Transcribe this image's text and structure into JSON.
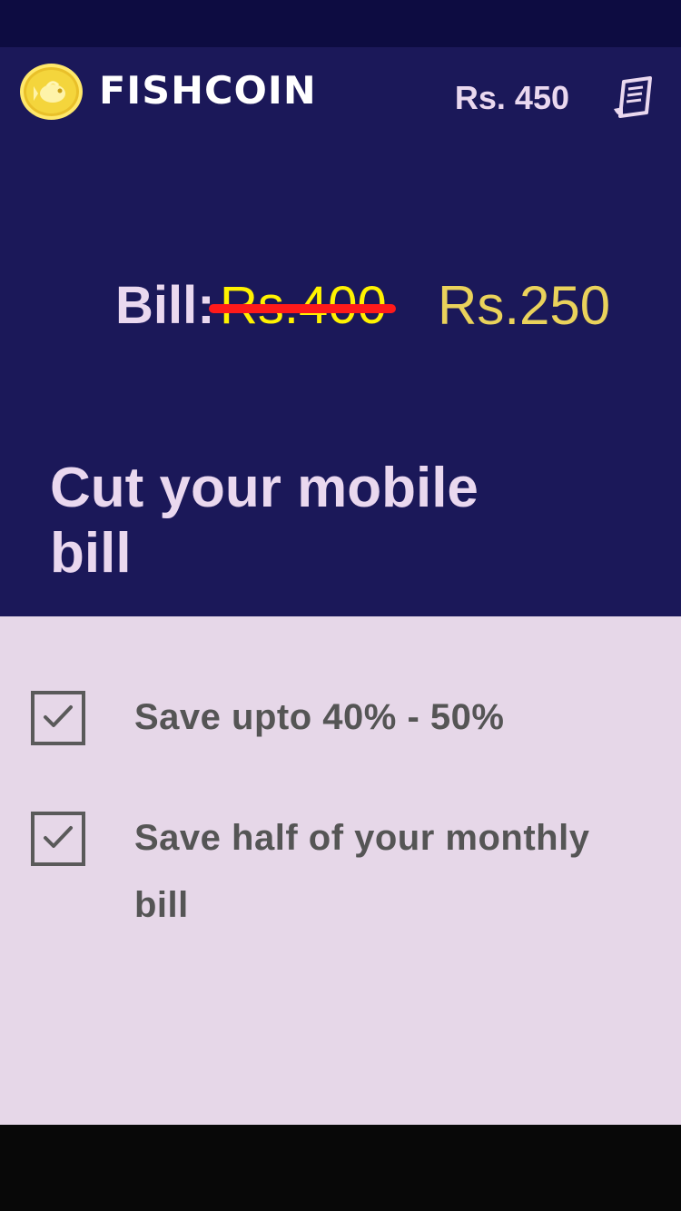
{
  "app": {
    "name": "FISHCOIN",
    "balance": "Rs. 450",
    "logo_icon": "fish-coin-icon",
    "receipt_icon": "receipt-icon"
  },
  "bill": {
    "label": "Bill:",
    "old_price": "Rs.400",
    "new_price": "Rs.250"
  },
  "hero": {
    "title": "Cut your mobile bill"
  },
  "features": [
    {
      "text": "Save upto 40% - 50%",
      "checked": true
    },
    {
      "text": "Save half of your monthly bill",
      "checked": true
    }
  ],
  "colors": {
    "status_bar": "#0d0c41",
    "hero_background": "#1b1859",
    "features_background": "#e6d7e8",
    "accent_yellow": "#ead25b",
    "strike_red": "#ff1a1a",
    "text_light": "#ead8ef",
    "text_dark": "#555555"
  }
}
